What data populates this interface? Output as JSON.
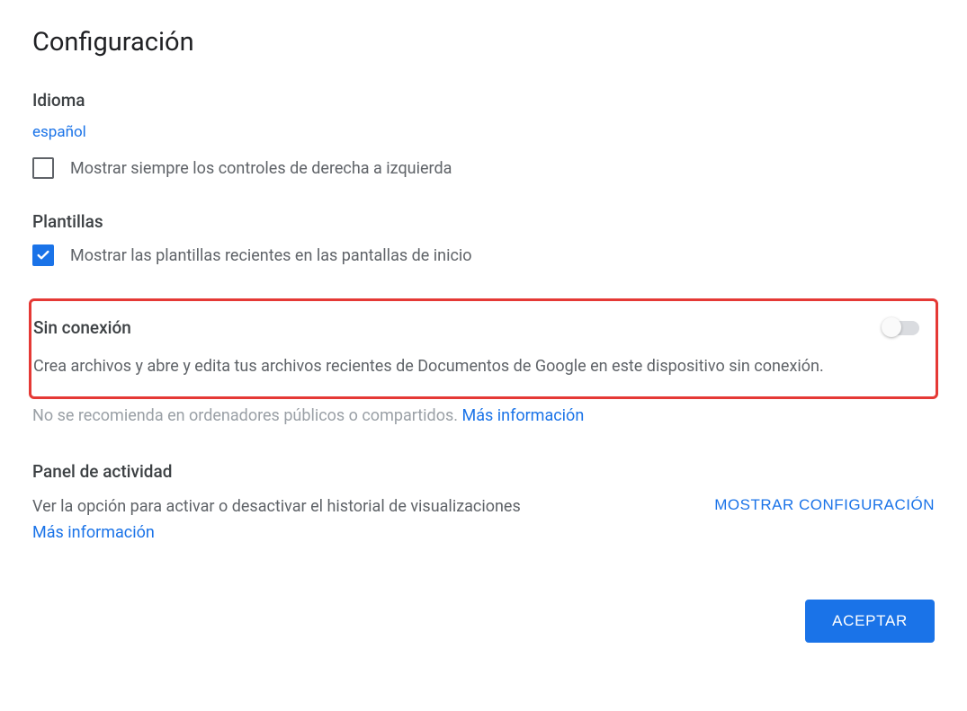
{
  "title": "Configuración",
  "language": {
    "heading": "Idioma",
    "selected": "español",
    "rtl_checkbox_label": "Mostrar siempre los controles de derecha a izquierda",
    "rtl_checked": false
  },
  "templates": {
    "heading": "Plantillas",
    "recent_checkbox_label": "Mostrar las plantillas recientes en las pantallas de inicio",
    "recent_checked": true
  },
  "offline": {
    "heading": "Sin conexión",
    "toggle_on": false,
    "description": "Crea archivos y abre y edita tus archivos recientes de Documentos de Google en este dispositivo sin conexión.",
    "warning_prefix": "No se recomienda en ordenadores públicos o compartidos. ",
    "more_info": "Más información"
  },
  "activity": {
    "heading": "Panel de actividad",
    "description": "Ver la opción para activar o desactivar el historial de visualizaciones",
    "more_info": "Más información",
    "show_config_button": "MOSTRAR CONFIGURACIÓN"
  },
  "footer": {
    "accept_button": "ACEPTAR"
  }
}
